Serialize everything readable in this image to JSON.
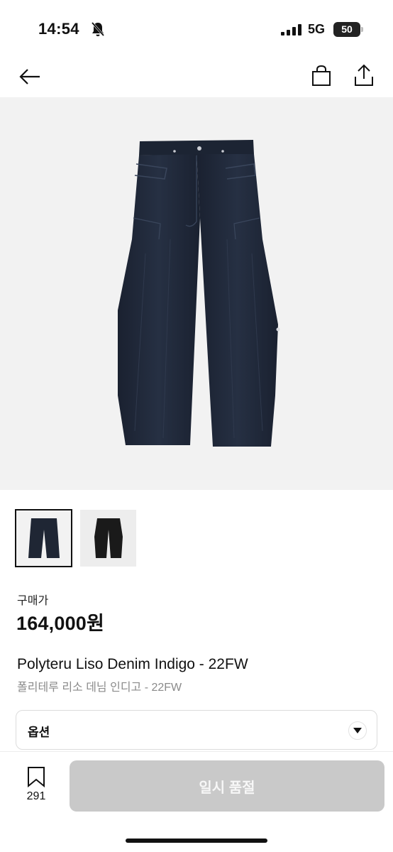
{
  "status_bar": {
    "time": "14:54",
    "network": "5G",
    "battery": "50",
    "icons": [
      "bell-slash-icon",
      "signal-icon",
      "battery-icon"
    ]
  },
  "nav": {
    "icons": [
      "back-arrow-icon",
      "shopping-bag-icon",
      "share-icon"
    ]
  },
  "product": {
    "images": [
      "denim-pants-front",
      "denim-pants-black"
    ],
    "selected_image": 0,
    "price_label": "구매가",
    "price": "164,000원",
    "title": "Polyteru Liso Denim Indigo - 22FW",
    "subtitle": "폴리테루 리소 데님 인디고 - 22FW"
  },
  "option": {
    "label": "옵션",
    "icon": "chevron-down-icon"
  },
  "bottom": {
    "bookmark_count": "291",
    "bookmark_icon": "bookmark-icon",
    "action_label": "일시 품절"
  },
  "colors": {
    "denim": "#1f2634",
    "black_pants": "#1a1a1a",
    "image_bg": "#f2f2f2",
    "disabled_button": "#c9c9c9"
  }
}
